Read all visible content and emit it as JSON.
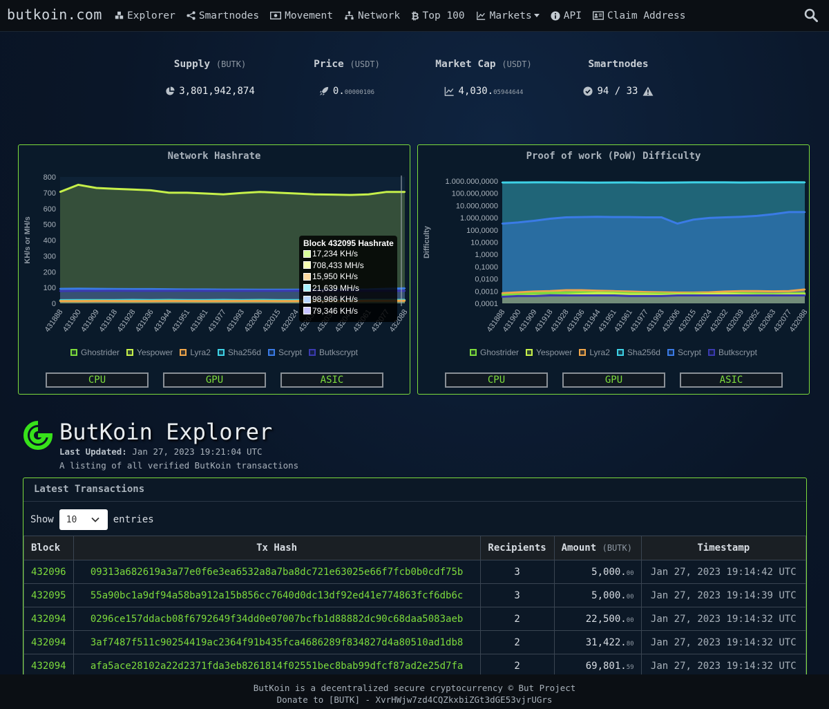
{
  "navbar": {
    "brand": "butkoin.com",
    "items": [
      {
        "label": "Explorer",
        "icon": "cubes-icon"
      },
      {
        "label": "Smartnodes",
        "icon": "share-nodes-icon"
      },
      {
        "label": "Movement",
        "icon": "money-bill-icon"
      },
      {
        "label": "Network",
        "icon": "network-icon"
      },
      {
        "label": "Top 100",
        "icon": "bitcoin-icon"
      },
      {
        "label": "Markets",
        "icon": "chart-line-icon"
      },
      {
        "label": "API",
        "icon": "info-circle-icon"
      },
      {
        "label": "Claim Address",
        "icon": "address-card-icon"
      }
    ],
    "search_icon": "search-icon"
  },
  "stats": {
    "supply": {
      "title": "Supply",
      "unit": "(BUTK)",
      "value": "3,801,942,874",
      "icon": "pie-chart-icon"
    },
    "price": {
      "title": "Price",
      "unit": "(USDT)",
      "value_main": "0.",
      "value_small": "00000106",
      "icon": "rocket-icon"
    },
    "market_cap": {
      "title": "Market Cap",
      "unit": "(USDT)",
      "value_main": "4,030.",
      "value_small": "05944644",
      "icon": "chart-line-icon"
    },
    "smartnodes": {
      "title": "Smartnodes",
      "value": "94 / 33",
      "icon": "check-circle-icon",
      "warn_icon": "warning-icon"
    }
  },
  "hashrate_panel": {
    "title": "Network Hashrate",
    "buttons": [
      "CPU",
      "GPU",
      "ASIC"
    ],
    "tooltip": {
      "title": "Block 432095 Hashrate",
      "rows": [
        {
          "text": "17,234 KH/s",
          "color": "#d8ff9a"
        },
        {
          "text": "708,433 MH/s",
          "color": "#f6ffb0"
        },
        {
          "text": "15,950 KH/s",
          "color": "#ffd9a0"
        },
        {
          "text": "21,639 MH/s",
          "color": "#a8f2ff"
        },
        {
          "text": "98,986 KH/s",
          "color": "#b9d6ff"
        },
        {
          "text": "79,346 KH/s",
          "color": "#c6c2ff"
        }
      ]
    }
  },
  "difficulty_panel": {
    "title": "Proof of work (PoW) Difficulty",
    "buttons": [
      "CPU",
      "GPU",
      "ASIC"
    ]
  },
  "legend": [
    {
      "name": "Ghostrider",
      "color": "#7ddc3c"
    },
    {
      "name": "Yespower",
      "color": "#c6f04a"
    },
    {
      "name": "Lyra2",
      "color": "#f0a64a"
    },
    {
      "name": "Sha256d",
      "color": "#3ed2e6"
    },
    {
      "name": "Scrypt",
      "color": "#3a7be6"
    },
    {
      "name": "Butkscrypt",
      "color": "#3a3ab0"
    }
  ],
  "chart_data": [
    {
      "type": "line",
      "title": "Network Hashrate",
      "ylabel": "KH/s or MH/s",
      "ylim": [
        0,
        800
      ],
      "yticks": [
        0,
        100,
        200,
        300,
        400,
        500,
        600,
        700,
        800
      ],
      "x": [
        "431888",
        "431900",
        "431909",
        "431918",
        "431928",
        "431936",
        "431944",
        "431951",
        "431961",
        "431977",
        "431993",
        "432006",
        "432015",
        "432024",
        "432032",
        "432039",
        "432046",
        "432061",
        "432077",
        "432088"
      ],
      "series": [
        {
          "name": "Ghostrider",
          "color": "#7ddc3c",
          "values": [
            15,
            14,
            16,
            15,
            14,
            15,
            16,
            15,
            14,
            15,
            15,
            16,
            15,
            14,
            16,
            15,
            15,
            17,
            16,
            17
          ]
        },
        {
          "name": "Yespower",
          "color": "#c6f04a",
          "values": [
            705,
            750,
            730,
            725,
            720,
            715,
            700,
            700,
            695,
            690,
            698,
            705,
            700,
            695,
            690,
            688,
            686,
            690,
            705,
            705
          ]
        },
        {
          "name": "Lyra2",
          "color": "#f0a64a",
          "values": [
            14,
            14,
            15,
            15,
            14,
            14,
            15,
            15,
            14,
            14,
            15,
            15,
            14,
            14,
            15,
            15,
            15,
            16,
            16,
            16
          ]
        },
        {
          "name": "Sha256d",
          "color": "#3ed2e6",
          "values": [
            20,
            21,
            21,
            21,
            22,
            21,
            22,
            21,
            21,
            22,
            21,
            22,
            21,
            21,
            22,
            22,
            21,
            22,
            22,
            22
          ]
        },
        {
          "name": "Scrypt",
          "color": "#3a7be6",
          "values": [
            92,
            93,
            92,
            91,
            90,
            90,
            89,
            88,
            88,
            87,
            87,
            86,
            86,
            86,
            86,
            86,
            87,
            88,
            92,
            95
          ]
        },
        {
          "name": "Butkscrypt",
          "color": "#3a3ab0",
          "values": [
            78,
            79,
            79,
            80,
            79,
            79,
            79,
            80,
            79,
            79,
            79,
            79,
            79,
            80,
            79,
            79,
            79,
            79,
            79,
            79
          ]
        }
      ]
    },
    {
      "type": "line",
      "title": "Proof of work (PoW) Difficulty",
      "ylabel": "Difficulty",
      "yscale": "log",
      "ylim": [
        0.0001,
        1000000000
      ],
      "yticks": [
        "0,0001",
        "0,0010",
        "0,0100",
        "0,1000",
        "1,0000",
        "10,0000",
        "100,0000",
        "1.000,0000",
        "10.000,0000",
        "100.000,0000",
        "1.000.000,0000"
      ],
      "x": [
        "431888",
        "431900",
        "431909",
        "431918",
        "431928",
        "431936",
        "431944",
        "431951",
        "431961",
        "431977",
        "431993",
        "432006",
        "432015",
        "432024",
        "432032",
        "432039",
        "432052",
        "432063",
        "432077",
        "432088"
      ],
      "series": [
        {
          "name": "Ghostrider",
          "color": "#7ddc3c",
          "values": [
            0.0008,
            0.0009,
            0.0012,
            0.0013,
            0.0014,
            0.0015,
            0.0014,
            0.0014,
            0.0012,
            0.0011,
            0.0011,
            0.001,
            0.0011,
            0.001,
            0.0011,
            0.0012,
            0.0011,
            0.001,
            0.0011,
            0.0012
          ]
        },
        {
          "name": "Yespower",
          "color": "#c6f04a",
          "values": [
            0.0005,
            0.0006,
            0.0007,
            0.0007,
            0.0008,
            0.001,
            0.0012,
            0.0011,
            0.0009,
            0.0009,
            0.0008,
            0.0009,
            0.0009,
            0.001,
            0.0011,
            0.0009,
            0.0008,
            0.0008,
            0.0009,
            0.0009
          ]
        },
        {
          "name": "Lyra2",
          "color": "#f0a64a",
          "values": [
            0.0012,
            0.0015,
            0.0018,
            0.002,
            0.0025,
            0.0025,
            0.0022,
            0.002,
            0.0018,
            0.0016,
            0.0015,
            0.0014,
            0.0014,
            0.0015,
            0.0018,
            0.002,
            0.002,
            0.0019,
            0.002,
            0.003
          ]
        },
        {
          "name": "Sha256d",
          "color": "#3ed2e6",
          "values": [
            700000000,
            710000000,
            720000000,
            730000000,
            710000000,
            700000000,
            690000000,
            700000000,
            710000000,
            690000000,
            680000000,
            700000000,
            720000000,
            730000000,
            720000000,
            700000000,
            710000000,
            720000000,
            750000000,
            720000000
          ]
        },
        {
          "name": "Scrypt",
          "color": "#3a7be6",
          "values": [
            30000,
            40000,
            60000,
            100000,
            140000,
            150000,
            160000,
            150000,
            150000,
            140000,
            140000,
            30000,
            80000,
            120000,
            140000,
            160000,
            200000,
            300000,
            500000,
            500000
          ]
        },
        {
          "name": "Butkscrypt",
          "color": "#3a3ab0",
          "values": [
            0.0005,
            0.0006,
            0.0006,
            0.0007,
            0.0007,
            0.0007,
            0.0007,
            0.0007,
            0.0006,
            0.0006,
            0.0006,
            0.0007,
            0.0007,
            0.0007,
            0.0007,
            0.0007,
            0.0007,
            0.0007,
            0.0007,
            0.0007
          ]
        }
      ]
    }
  ],
  "explorer": {
    "title": "ButKoin Explorer",
    "last_updated_label": "Last Updated:",
    "last_updated_value": "Jan 27, 2023 19:21:04 UTC",
    "subtitle": "A listing of all verified ButKoin transactions",
    "logo_icon": "butkoin-logo-icon"
  },
  "transactions": {
    "card_title": "Latest Transactions",
    "show_label": "Show",
    "entries_value": "10",
    "entries_label": "entries",
    "columns": [
      "Block",
      "Tx Hash",
      "Recipients",
      "Amount",
      "Timestamp"
    ],
    "amount_unit": "(BUTK)",
    "rows": [
      {
        "block": "432096",
        "hash": "09313a682619a3a77e0f6e3ea6532a8a7ba8dc721e63025e66f7fcb0b0cdf75b",
        "recipients": "3",
        "amount": "5,000.",
        "decimals": "00",
        "timestamp": "Jan 27, 2023 19:14:42 UTC"
      },
      {
        "block": "432095",
        "hash": "55a90bc1a9df94a58ba912a15b856cc7640d0dc13df92ed41e774863fcf6db6c",
        "recipients": "3",
        "amount": "5,000.",
        "decimals": "00",
        "timestamp": "Jan 27, 2023 19:14:39 UTC"
      },
      {
        "block": "432094",
        "hash": "0296ce157ddacb08f6792649f34dd0e07007bcfb1d88882dc90c68daa5083aeb",
        "recipients": "2",
        "amount": "22,500.",
        "decimals": "00",
        "timestamp": "Jan 27, 2023 19:14:32 UTC"
      },
      {
        "block": "432094",
        "hash": "3af7487f511c90254419ac2364f91b435fca4686289f834827d4a80510ad1db8",
        "recipients": "2",
        "amount": "31,422.",
        "decimals": "80",
        "timestamp": "Jan 27, 2023 19:14:32 UTC"
      },
      {
        "block": "432094",
        "hash": "afa5ace28102a22d2371fda3eb8261814f02551bec8bab99dfcf87ad2e25d7fa",
        "recipients": "2",
        "amount": "69,801.",
        "decimals": "59",
        "timestamp": "Jan 27, 2023 19:14:32 UTC"
      }
    ]
  },
  "footer": {
    "line1": "ButKoin is a decentralized secure cryptocurrency © But Project",
    "line2": "Donate to [BUTK] - XvrHWjw7zd4CQZkxbiZGt3dGE53vjrUGrs"
  }
}
